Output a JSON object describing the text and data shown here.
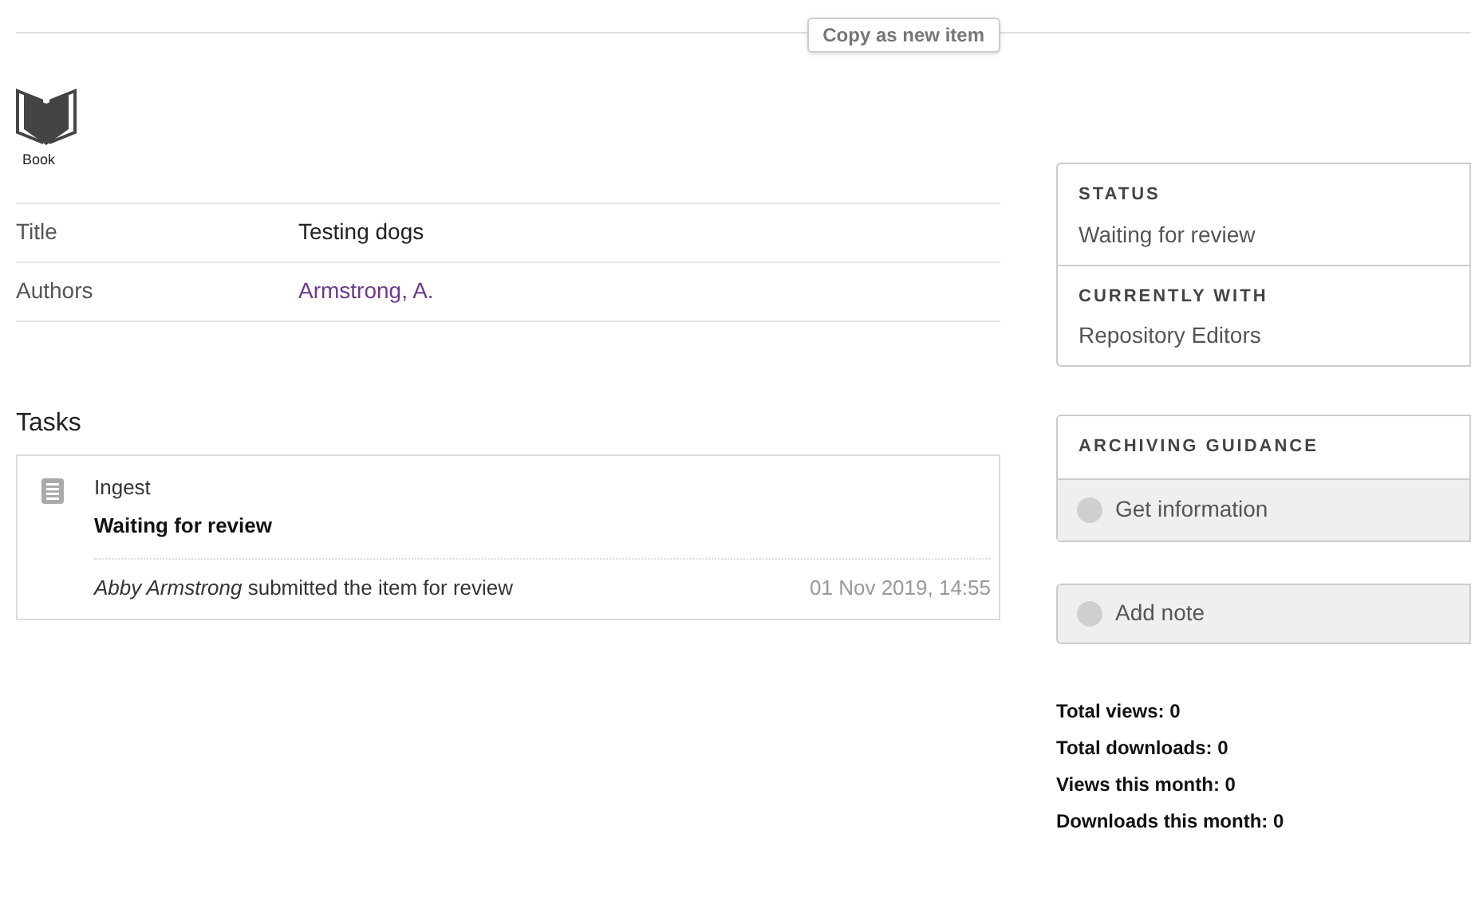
{
  "copy_button": {
    "label": "Copy as new item"
  },
  "item_type": {
    "label": "Book"
  },
  "fields": [
    {
      "label": "Title",
      "value": "Testing dogs",
      "kind": "text"
    },
    {
      "label": "Authors",
      "value": "Armstrong, A.",
      "kind": "link"
    }
  ],
  "tasks": {
    "heading": "Tasks",
    "items": [
      {
        "name": "Ingest",
        "status": "Waiting for review",
        "event": "*Abby Armstrong* submitted the item for review",
        "time": "01 Nov 2019, 14:55"
      }
    ]
  },
  "status_panel": [
    {
      "heading": "STATUS",
      "value": "Waiting for review"
    },
    {
      "heading": "CURRENTLY WITH",
      "value": "Repository Editors"
    }
  ],
  "guidance_panel": {
    "heading": "ARCHIVING GUIDANCE",
    "action": "Get information"
  },
  "note_button": {
    "label": "Add note"
  },
  "stats": [
    "Total views: 0",
    "Total downloads: 0",
    "Views this month: 0",
    "Downloads this month: 0"
  ]
}
